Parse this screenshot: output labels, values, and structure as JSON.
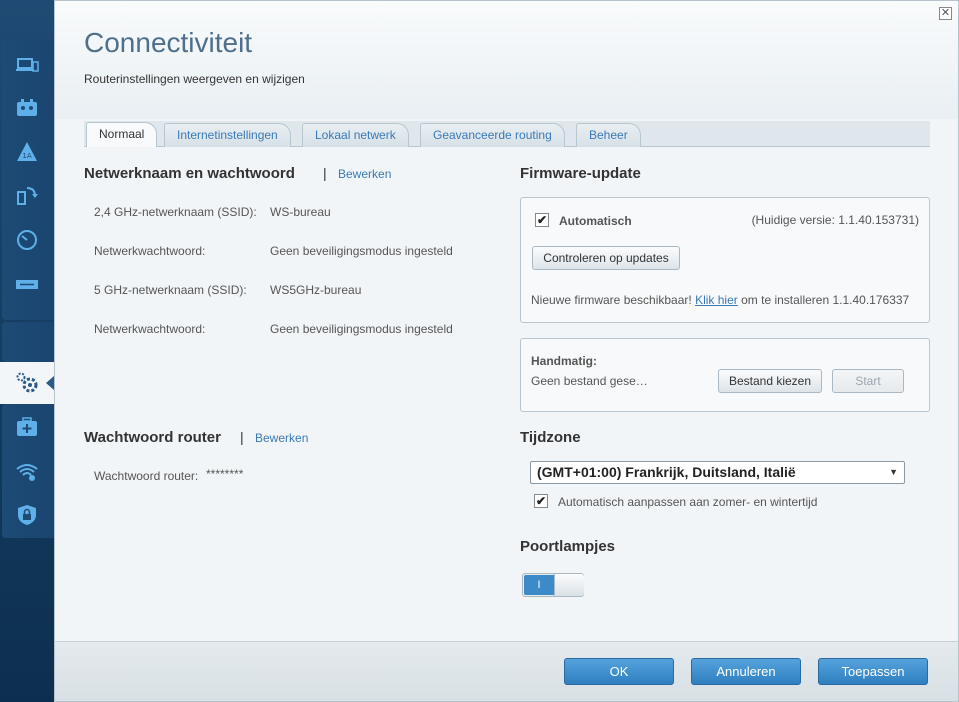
{
  "header": {
    "title": "Connectiviteit",
    "subtitle": "Routerinstellingen weergeven en wijzigen",
    "close_label": "✕"
  },
  "tabs": [
    {
      "label": "Normaal",
      "active": true
    },
    {
      "label": "Internetinstellingen"
    },
    {
      "label": "Lokaal netwerk"
    },
    {
      "label": "Geavanceerde routing"
    },
    {
      "label": "Beheer"
    }
  ],
  "network": {
    "heading": "Netwerknaam en wachtwoord",
    "separator": "|",
    "edit_label": "Bewerken",
    "rows": [
      {
        "label": "2,4 GHz-netwerknaam (SSID):",
        "value": "WS-bureau"
      },
      {
        "label": "Netwerkwachtwoord:",
        "value": "Geen beveiligingsmodus ingesteld"
      },
      {
        "label": "5 GHz-netwerknaam (SSID):",
        "value": "WS5GHz-bureau"
      },
      {
        "label": "Netwerkwachtwoord:",
        "value": "Geen beveiligingsmodus ingesteld"
      }
    ]
  },
  "router_password": {
    "heading": "Wachtwoord router",
    "separator": "|",
    "edit_label": "Bewerken",
    "label": "Wachtwoord router:",
    "value": "********"
  },
  "firmware": {
    "heading": "Firmware-update",
    "auto_label": "Automatisch",
    "auto_checked": "✔",
    "current_version": "(Huidige versie: 1.1.40.153731)",
    "check_button": "Controleren op updates",
    "new_text_before": "Nieuwe firmware beschikbaar!",
    "new_link": "Klik hier",
    "new_text_after": "om te installeren 1.1.40.176337",
    "manual_label": "Handmatig:",
    "no_file": "Geen bestand gese…",
    "choose_button": "Bestand kiezen",
    "start_button": "Start"
  },
  "timezone": {
    "heading": "Tijdzone",
    "selected": "(GMT+01:00) Frankrijk, Duitsland, Italië",
    "arrow": "▼",
    "dst_checked": "✔",
    "dst_label": "Automatisch aanpassen aan zomer- en wintertijd"
  },
  "port_lights": {
    "heading": "Poortlampjes",
    "toggle_on_label": "I"
  },
  "footer": {
    "ok": "OK",
    "cancel": "Annuleren",
    "apply": "Toepassen"
  },
  "sidebar": {
    "icons": [
      "device-list-icon",
      "parental-control-icon",
      "speed-test-icon",
      "media-prioritization-icon",
      "speed-check-icon",
      "usb-storage-icon",
      "connectivity-icon",
      "troubleshooting-icon",
      "wireless-icon",
      "security-icon"
    ]
  },
  "colors": {
    "accent": "#3a79b5",
    "button_blue": "#2f7fc0",
    "sidebar_bg": "#1f4a73"
  }
}
